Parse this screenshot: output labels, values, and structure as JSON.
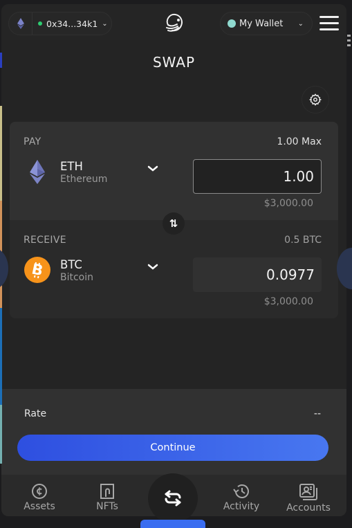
{
  "header": {
    "network_icon": "ethereum-icon",
    "address": "0x34...34k1",
    "address_status_color": "#2ecc71",
    "logo_icon": "app-logo-icon",
    "wallet_name": "My Wallet",
    "wallet_color": "#8fd9cf",
    "menu_icon": "hamburger-menu-icon"
  },
  "page": {
    "title": "SWAP",
    "settings_icon": "gear-icon"
  },
  "pay": {
    "label": "PAY",
    "balance": "1.00 Max",
    "token_symbol": "ETH",
    "token_name": "Ethereum",
    "amount": "1.00",
    "usd_value": "$3,000.00"
  },
  "receive": {
    "label": "RECEIVE",
    "balance": "0.5 BTC",
    "token_symbol": "BTC",
    "token_name": "Bitcoin",
    "amount": "0.0977",
    "usd_value": "$3,000.00"
  },
  "flip": {
    "icon": "swap-direction-icon",
    "glyph": "⇅"
  },
  "rate": {
    "label": "Rate",
    "value": "--"
  },
  "continue_label": "Continue",
  "accent_color": "#3a6df0",
  "nav": {
    "items": [
      {
        "label": "Assets",
        "icon": "assets-icon"
      },
      {
        "label": "NFTs",
        "icon": "nft-icon"
      },
      {
        "label": "",
        "icon": "swap-icon",
        "active": true
      },
      {
        "label": "Activity",
        "icon": "history-icon"
      },
      {
        "label": "Accounts",
        "icon": "accounts-icon"
      }
    ]
  }
}
